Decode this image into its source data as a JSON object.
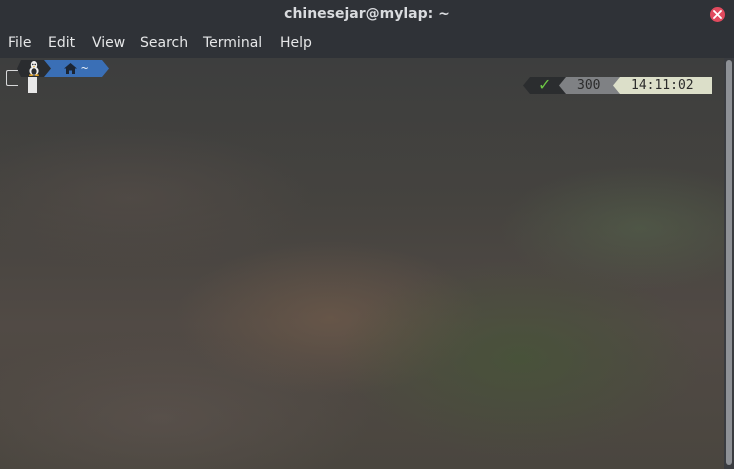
{
  "window": {
    "title": "chinesejar@mylap: ~",
    "close_icon": "close-icon",
    "accent_close": "#e14a5e"
  },
  "menubar": {
    "items": [
      "File",
      "Edit",
      "View",
      "Search",
      "Terminal",
      "Help"
    ]
  },
  "prompt": {
    "os_icon": "linux-tux-icon",
    "home_icon": "home-icon",
    "path": "~",
    "path_bg": "#3a6fb6"
  },
  "right_prompt": {
    "status_icon": "check-icon",
    "status_symbol": "✓",
    "status_color": "#6cc644",
    "count": "300",
    "time": "14:11:02"
  }
}
